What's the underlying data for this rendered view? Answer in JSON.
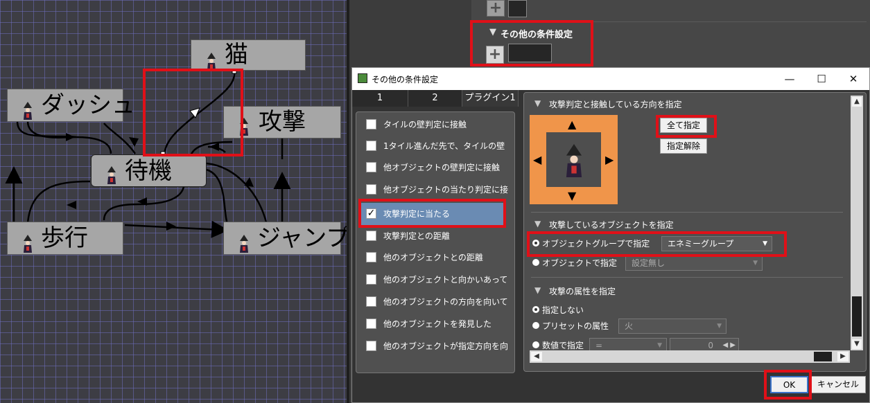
{
  "graph": {
    "nodes": {
      "cat": "猫",
      "dash": "ダッシュ",
      "attack": "攻撃",
      "wait": "待機",
      "walk": "歩行",
      "jump": "ジャンプ"
    }
  },
  "side_panel": {
    "section_title": "その他の条件設定",
    "add_icon": "plus-icon"
  },
  "dialog": {
    "title": "その他の条件設定",
    "window_controls": {
      "minimize": "—",
      "maximize": "☐",
      "close": "✕"
    },
    "tabs": [
      "1",
      "2",
      "プラグイン1"
    ],
    "conditions": [
      {
        "label": "タイルの壁判定に接触",
        "checked": false
      },
      {
        "label": "1タイル進んだ先で、タイルの壁",
        "checked": false
      },
      {
        "label": "他オブジェクトの壁判定に接触",
        "checked": false
      },
      {
        "label": "他オブジェクトの当たり判定に接",
        "checked": false
      },
      {
        "label": "攻撃判定に当たる",
        "checked": true
      },
      {
        "label": "攻撃判定との距離",
        "checked": false
      },
      {
        "label": "他のオブジェクトとの距離",
        "checked": false
      },
      {
        "label": "他のオブジェクトと向かいあって",
        "checked": false
      },
      {
        "label": "他のオブジェクトの方向を向いて",
        "checked": false
      },
      {
        "label": "他のオブジェクトを発見した",
        "checked": false
      },
      {
        "label": "他のオブジェクトが指定方向を向",
        "checked": false
      }
    ],
    "direction_section": {
      "title": "攻撃判定と接触している方向を指定",
      "select_all": "全て指定",
      "deselect": "指定解除",
      "arrows": {
        "up": "▲",
        "down": "▼",
        "left": "◀",
        "right": "▶"
      }
    },
    "object_section": {
      "title": "攻撃しているオブジェクトを指定",
      "by_group_label": "オブジェクトグループで指定",
      "group_value": "エネミーグループ",
      "by_object_label": "オブジェクトで指定",
      "object_value": "設定無し"
    },
    "attribute_section": {
      "title": "攻撃の属性を指定",
      "none_label": "指定しない",
      "preset_label": "プリセットの属性",
      "preset_value": "火",
      "numeric_label": "数値で指定",
      "numeric_op": "=",
      "numeric_value": "0"
    },
    "ok": "OK",
    "cancel": "キャンセル"
  },
  "colors": {
    "highlight_red": "#e01018",
    "selection_blue": "#6a8bb3",
    "arrow_pad_orange": "#f0954a"
  }
}
